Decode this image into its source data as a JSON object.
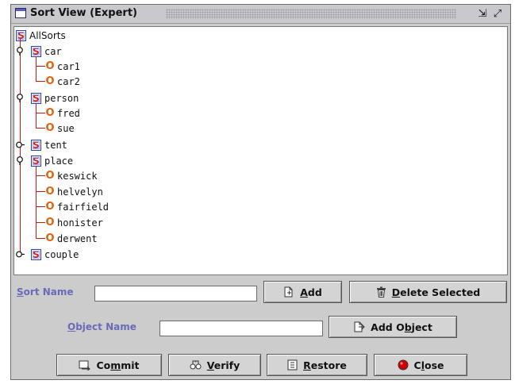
{
  "window": {
    "title": "Sort View (Expert)",
    "controls": [
      {
        "name": "restore-icon",
        "glyph": "⇲"
      },
      {
        "name": "maximize-icon",
        "glyph": "⤢"
      }
    ]
  },
  "tree": {
    "root": {
      "icon": "S",
      "label": "AllSorts"
    },
    "sorts": [
      {
        "icon": "S",
        "label": "car",
        "expanded": true,
        "objects": [
          {
            "icon": "O",
            "label": "car1"
          },
          {
            "icon": "O",
            "label": "car2"
          }
        ]
      },
      {
        "icon": "S",
        "label": "person",
        "expanded": true,
        "objects": [
          {
            "icon": "O",
            "label": "fred"
          },
          {
            "icon": "O",
            "label": "sue"
          }
        ]
      },
      {
        "icon": "S",
        "label": "tent",
        "expanded": false,
        "objects": []
      },
      {
        "icon": "S",
        "label": "place",
        "expanded": true,
        "objects": [
          {
            "icon": "O",
            "label": "keswick"
          },
          {
            "icon": "O",
            "label": "helvelyn"
          },
          {
            "icon": "O",
            "label": "fairfield"
          },
          {
            "icon": "O",
            "label": "honister"
          },
          {
            "icon": "O",
            "label": "derwent"
          }
        ]
      },
      {
        "icon": "S",
        "label": "couple",
        "expanded": false,
        "objects": []
      }
    ]
  },
  "form": {
    "sort_name": {
      "label_mnemonic": "S",
      "label_rest": "ort Name",
      "value": ""
    },
    "object_name": {
      "label_mnemonic": "O",
      "label_rest": "bject Name",
      "value": ""
    },
    "add_button": {
      "icon": "add-doc-icon",
      "mnemonic": "A",
      "rest": "dd"
    },
    "delete_button": {
      "icon": "trash-icon",
      "mnemonic": "D",
      "rest": "elete Selected"
    },
    "add_object_button": {
      "icon": "add-object-icon",
      "prefix": "Add O",
      "mnemonic": "b",
      "rest": "ject"
    }
  },
  "actions": {
    "commit": {
      "icon": "commit-icon",
      "prefix": "Co",
      "mnemonic": "m",
      "rest": "mit"
    },
    "verify": {
      "icon": "verify-icon",
      "prefix": "",
      "mnemonic": "V",
      "rest": "erify"
    },
    "restore": {
      "icon": "restore-doc-icon",
      "prefix": "",
      "mnemonic": "R",
      "rest": "estore"
    },
    "close": {
      "icon": "stop-icon",
      "prefix": "C",
      "mnemonic": "l",
      "rest": "ose"
    }
  },
  "colors": {
    "tree_line": "#d11414",
    "sort_icon_border": "#1e3fd0",
    "sort_icon_letter": "#d81f1f",
    "object_icon": "#e0620a",
    "form_label": "#6a6ab8",
    "close_icon": "#d00000"
  }
}
